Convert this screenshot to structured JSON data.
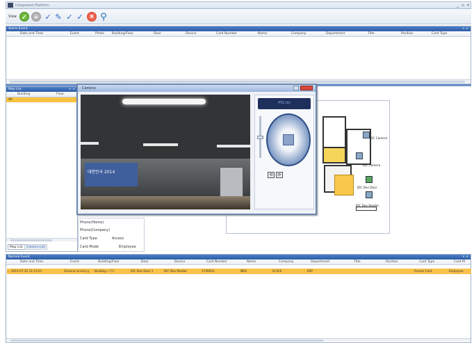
{
  "window": {
    "title": "Integrated Platform",
    "min": "_",
    "max": "▫",
    "close": "×"
  },
  "toolbar": {
    "view_label": "View"
  },
  "alarm_event": {
    "title": "Alarm Event",
    "close": "× ×",
    "columns": [
      "Date and Time",
      "Event",
      "Photo",
      "Building/Floor",
      "Door",
      "Device",
      "Card Number",
      "Name",
      "Company",
      "Department",
      "Title",
      "Position",
      "Card Type"
    ]
  },
  "map_list": {
    "title": "Map List",
    "close": "× ×",
    "columns": [
      "Building",
      "Floor"
    ],
    "selected_item": "All",
    "tabs": [
      "Map List",
      "Camera List"
    ]
  },
  "video_window": {
    "title": "Camera",
    "banner": "대한민국 2014",
    "ptz_label": "PTZ ctrl"
  },
  "properties": {
    "rows": [
      {
        "label": "Phone(Home)",
        "value": ""
      },
      {
        "label": "Phone(Company)",
        "value": ""
      },
      {
        "label": "Card Type",
        "value": "Access"
      },
      {
        "label": "Card Mode",
        "value": "Employee"
      }
    ]
  },
  "floor_map": {
    "labels": [
      "IDC Camera",
      "IDC Camera",
      "IDC Dev Door",
      "IDC Dev Reader"
    ]
  },
  "normal_event": {
    "title": "Normal Event",
    "close": "× ×",
    "columns": [
      "Date and Time",
      "Event",
      "Building/Floor",
      "Door",
      "Device",
      "Card Number",
      "Name",
      "Company",
      "Department",
      "Title",
      "Position",
      "Card Type",
      "Card M"
    ],
    "rows": [
      {
        "time": "2015-07-22 11:15:21",
        "event": "General access g",
        "building": "Building ~ F1",
        "door": "IDC Dev Door 1",
        "device": "IDC Dev Reader",
        "card": "1740931",
        "name": "NDS",
        "company": "IS-SCE",
        "department": "ESP",
        "card_type": "Access Card",
        "card_mode": "Employee"
      }
    ]
  }
}
